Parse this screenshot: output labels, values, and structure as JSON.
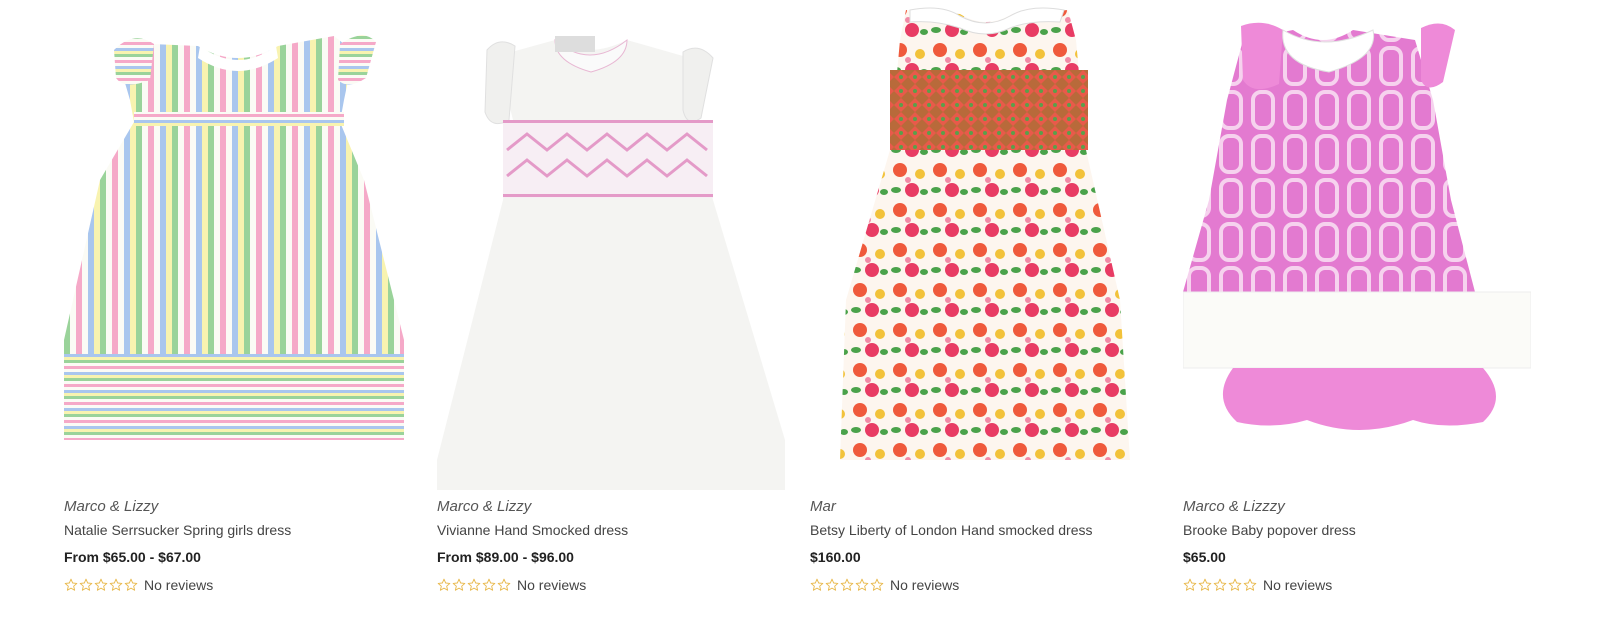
{
  "products": [
    {
      "vendor": "Marco & Lizzy",
      "title": "Natalie Serrsucker Spring girls dress",
      "price": "From $65.00 - $67.00",
      "reviews": "No reviews",
      "image": "striped-dress-image"
    },
    {
      "vendor": "Marco & Lizzy",
      "title": "Vivianne Hand Smocked dress",
      "price": "From $89.00 - $96.00",
      "reviews": "No reviews",
      "image": "white-smocked-dress-image"
    },
    {
      "vendor": "Mar",
      "title": "Betsy Liberty of London Hand smocked dress",
      "price": "$160.00",
      "reviews": "No reviews",
      "image": "floral-dress-image"
    },
    {
      "vendor": "Marco & Lizzzy",
      "title": "Brooke Baby popover dress",
      "price": "$65.00",
      "reviews": "No reviews",
      "image": "pink-popover-dress-image"
    }
  ],
  "colors": {
    "star_outline": "#e8b84a",
    "price": "#222222",
    "text": "#444444"
  }
}
